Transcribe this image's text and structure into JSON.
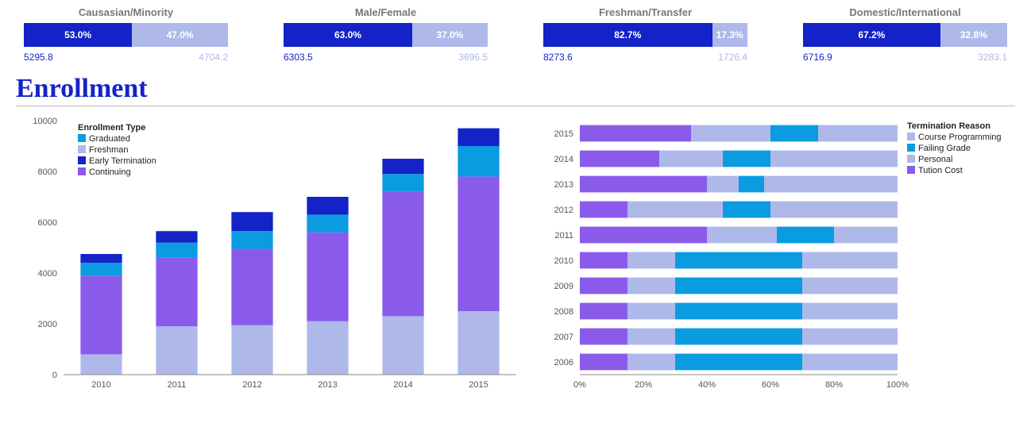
{
  "kpis": [
    {
      "title": "Causasian/Minority",
      "aPct": 53.0,
      "bPct": 47.0,
      "aVal": "5295.8",
      "bVal": "4704.2"
    },
    {
      "title": "Male/Female",
      "aPct": 63.0,
      "bPct": 37.0,
      "aVal": "6303.5",
      "bVal": "3696.5"
    },
    {
      "title": "Freshman/Transfer",
      "aPct": 82.7,
      "bPct": 17.3,
      "aVal": "8273.6",
      "bVal": "1726.4"
    },
    {
      "title": "Domestic/International",
      "aPct": 67.2,
      "bPct": 32.8,
      "aVal": "6716.9",
      "bVal": "3283.1"
    }
  ],
  "section_title": "Enrollment",
  "chart_data": [
    {
      "type": "bar",
      "subtype": "stacked",
      "title": "",
      "legend_title": "Enrollment Type",
      "xlabel": "",
      "ylabel": "",
      "ylim": [
        0,
        10000
      ],
      "yticks": [
        0,
        2000,
        4000,
        6000,
        8000,
        10000
      ],
      "categories": [
        "2010",
        "2011",
        "2012",
        "2013",
        "2014",
        "2015"
      ],
      "series": [
        {
          "name": "Continuing",
          "color": "#8a5bea",
          "values": [
            3100,
            2700,
            3000,
            3500,
            4900,
            5300
          ]
        },
        {
          "name": "Freshman",
          "color": "#aeb9ea",
          "values": [
            800,
            1900,
            1950,
            2100,
            2300,
            2500
          ]
        },
        {
          "name": "Graduated",
          "color": "#0a9be0",
          "values": [
            500,
            600,
            700,
            700,
            700,
            1200
          ]
        },
        {
          "name": "Early Termination",
          "color": "#1323c8",
          "values": [
            350,
            450,
            750,
            700,
            600,
            700
          ]
        }
      ],
      "legend_order": [
        "Graduated",
        "Freshman",
        "Early Termination",
        "Continuing"
      ]
    },
    {
      "type": "bar",
      "subtype": "stacked100_horizontal",
      "title": "",
      "legend_title": "Termination Reason",
      "xlabel": "",
      "ylabel": "",
      "xlim": [
        0,
        100
      ],
      "xticks": [
        0,
        20,
        40,
        60,
        80,
        100
      ],
      "categories": [
        "2015",
        "2014",
        "2013",
        "2012",
        "2011",
        "2010",
        "2009",
        "2008",
        "2007",
        "2006"
      ],
      "series": [
        {
          "name": "Tution Cost",
          "color": "#8a5bea",
          "values": [
            35,
            25,
            40,
            15,
            40,
            15,
            15,
            15,
            15,
            15
          ]
        },
        {
          "name": "Course Programming",
          "color": "#aeb9ea",
          "values": [
            25,
            20,
            10,
            30,
            22,
            15,
            15,
            15,
            15,
            15
          ]
        },
        {
          "name": "Failing Grade",
          "color": "#0a9be0",
          "values": [
            15,
            15,
            8,
            15,
            18,
            40,
            40,
            40,
            40,
            40
          ]
        },
        {
          "name": "Personal",
          "color": "#aeb9ea",
          "values": [
            25,
            40,
            42,
            40,
            20,
            30,
            30,
            30,
            30,
            30
          ]
        }
      ],
      "legend_order": [
        "Course Programming",
        "Failing Grade",
        "Personal",
        "Tution Cost"
      ]
    }
  ]
}
